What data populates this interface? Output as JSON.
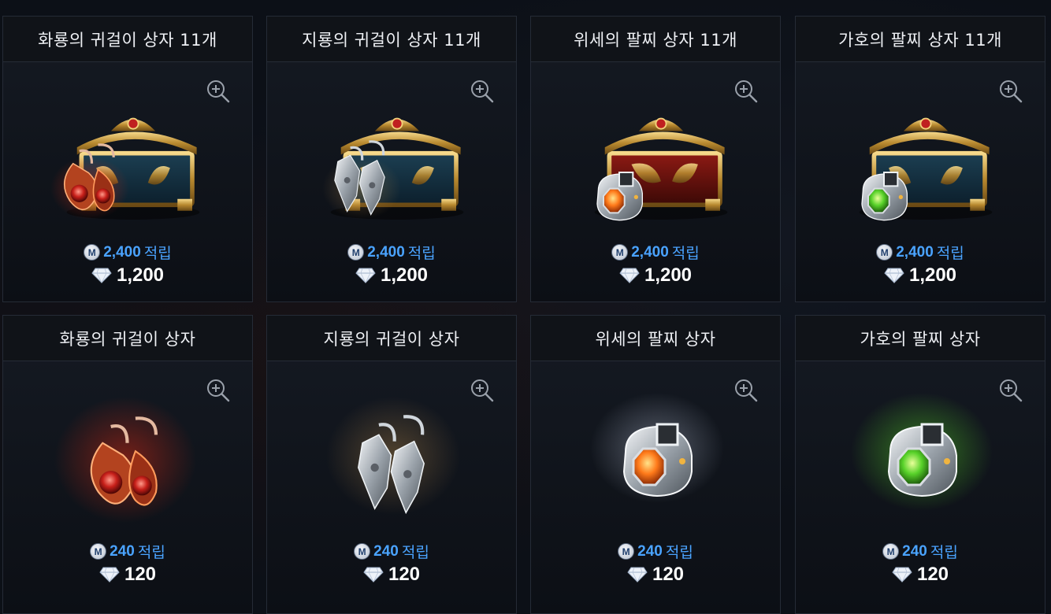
{
  "products": [
    {
      "title": "화룡의 귀걸이 상자 11개",
      "mileage": "2,400",
      "mileage_suffix": "적립",
      "price": "1,200",
      "icon": "earring-box-red-icon"
    },
    {
      "title": "지룡의 귀걸이 상자 11개",
      "mileage": "2,400",
      "mileage_suffix": "적립",
      "price": "1,200",
      "icon": "earring-box-silver-icon"
    },
    {
      "title": "위세의 팔찌 상자 11개",
      "mileage": "2,400",
      "mileage_suffix": "적립",
      "price": "1,200",
      "icon": "bracelet-box-orange-icon"
    },
    {
      "title": "가호의 팔찌 상자 11개",
      "mileage": "2,400",
      "mileage_suffix": "적립",
      "price": "1,200",
      "icon": "bracelet-box-green-icon"
    },
    {
      "title": "화룡의 귀걸이 상자",
      "mileage": "240",
      "mileage_suffix": "적립",
      "price": "120",
      "icon": "red-earring-icon"
    },
    {
      "title": "지룡의 귀걸이 상자",
      "mileage": "240",
      "mileage_suffix": "적립",
      "price": "120",
      "icon": "silver-earring-icon"
    },
    {
      "title": "위세의 팔찌 상자",
      "mileage": "240",
      "mileage_suffix": "적립",
      "price": "120",
      "icon": "orange-bracelet-icon"
    },
    {
      "title": "가호의 팔찌 상자",
      "mileage": "240",
      "mileage_suffix": "적립",
      "price": "120",
      "icon": "green-bracelet-icon"
    }
  ],
  "mileage_badge_letter": "M",
  "colors": {
    "mileage": "#4aa3ff",
    "title": "#eef0f4",
    "price": "#ffffff",
    "background": "#0c1017"
  }
}
